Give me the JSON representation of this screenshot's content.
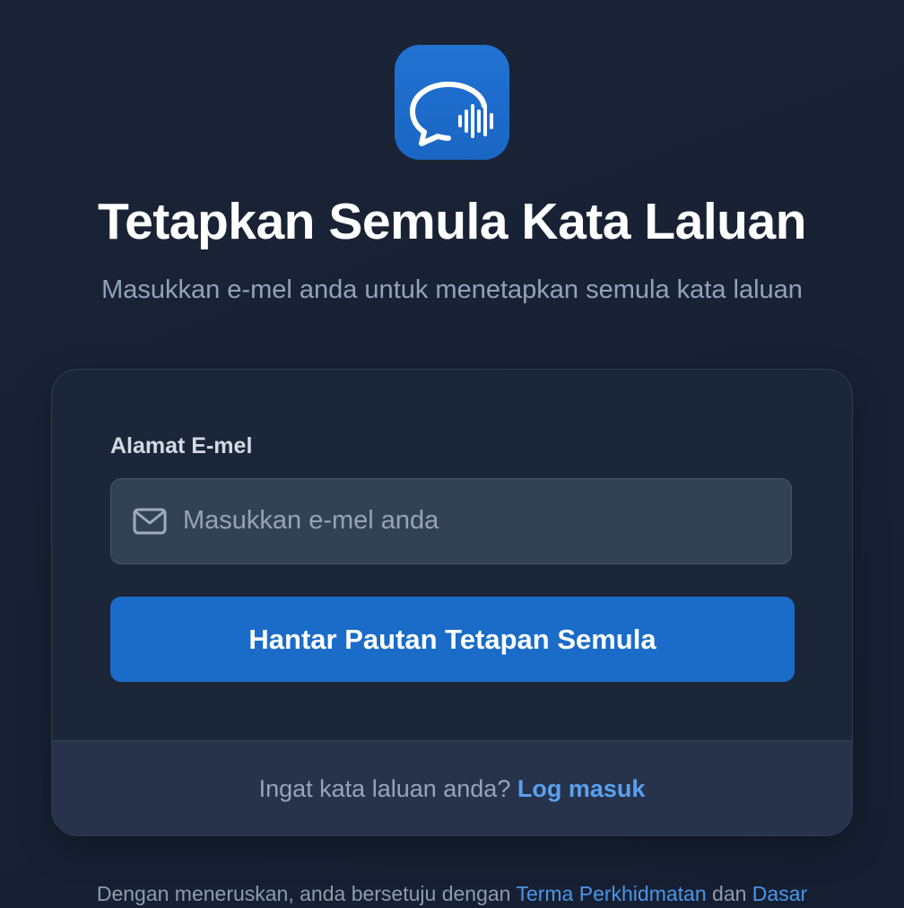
{
  "app": {
    "logo_icon": "chat-bubble-soundwave-icon",
    "accent_color": "#1b6cc8",
    "link_color": "#5aa0f0"
  },
  "header": {
    "title": "Tetapkan Semula Kata Laluan",
    "subtitle": "Masukkan e-mel anda untuk menetapkan semula kata laluan"
  },
  "form": {
    "email_label": "Alamat E-mel",
    "email_icon": "mail-icon",
    "email_placeholder": "Masukkan e-mel anda",
    "email_value": "",
    "submit_label": "Hantar Pautan Tetapan Semula"
  },
  "footer": {
    "prompt": "Ingat kata laluan anda?",
    "login_link": "Log masuk"
  },
  "terms": {
    "prefix": "Dengan meneruskan, anda bersetuju dengan",
    "terms_link": "Terma Perkhidmatan",
    "conjunction": "dan",
    "policy_link": "Dasar"
  }
}
